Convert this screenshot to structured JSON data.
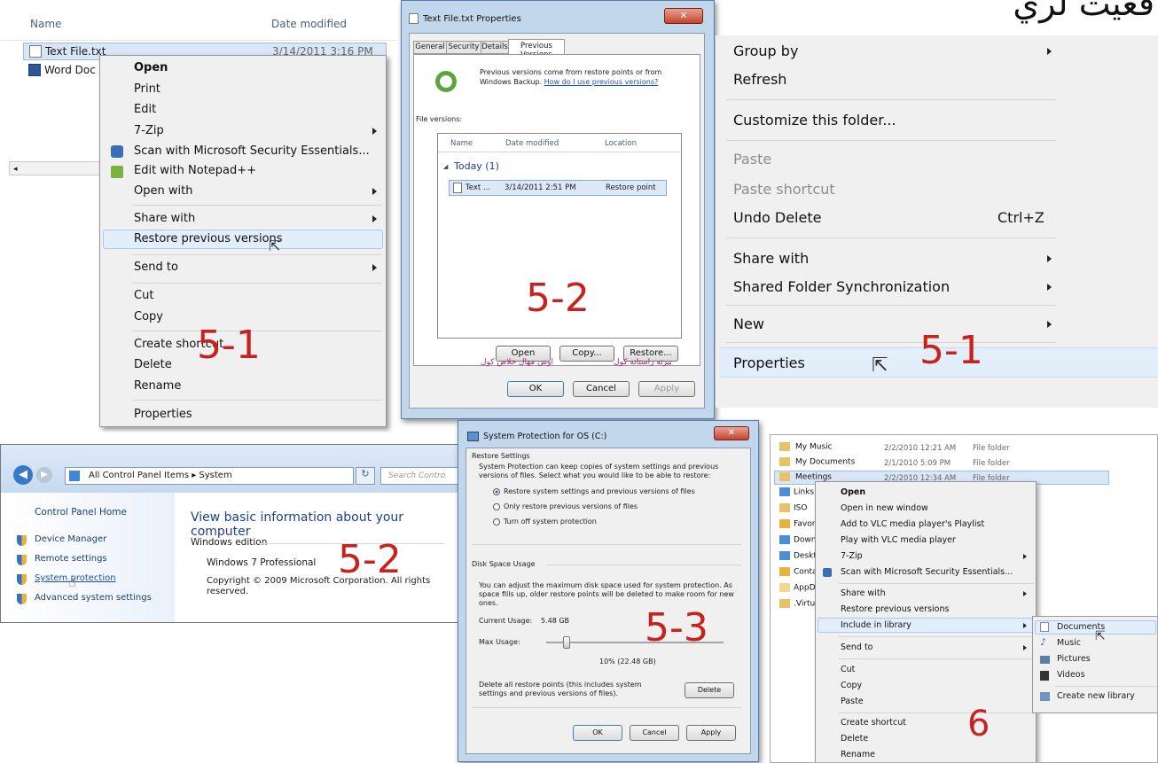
{
  "corner_text": "قعيت لري",
  "p1": {
    "col_name": "Name",
    "col_date": "Date modified",
    "files": [
      {
        "name": "Text File.txt",
        "date": "3/14/2011 3:16 PM"
      },
      {
        "name": "Word Doc -",
        "date": ""
      }
    ],
    "menu": [
      "Open",
      "Print",
      "Edit",
      "7-Zip",
      "Scan with Microsoft Security Essentials...",
      "Edit with Notepad++",
      "Open with",
      "Share with",
      "Restore previous versions",
      "Send to",
      "Cut",
      "Copy",
      "Create shortcut",
      "Delete",
      "Rename",
      "Properties"
    ],
    "label": "5-1"
  },
  "p2": {
    "title": "Text File.txt Properties",
    "tabs": [
      "General",
      "Security",
      "Details",
      "Previous Versions"
    ],
    "info": "Previous versions come from restore points or from Windows Backup.",
    "info_link": "How do I use previous versions?",
    "file_versions": "File versions:",
    "cols": [
      "Name",
      "Date modified",
      "Location"
    ],
    "group": "Today (1)",
    "row": {
      "name": "Text ...",
      "date": "3/14/2011 2:51 PM",
      "location": "Restore point"
    },
    "label": "5-2",
    "btns": [
      "Open",
      "Copy...",
      "Restore..."
    ],
    "note_left": "اوس مهال خلاص كول",
    "note_right": "بيرته راستانه كول",
    "footer_btns": [
      "OK",
      "Cancel",
      "Apply"
    ]
  },
  "p3": {
    "items": [
      {
        "label": "Group by",
        "arrow": true,
        "grey": false
      },
      {
        "label": "Refresh",
        "arrow": false,
        "grey": false
      },
      {
        "label": "Customize this folder...",
        "arrow": false,
        "grey": false
      },
      {
        "label": "Paste",
        "arrow": false,
        "grey": true
      },
      {
        "label": "Paste shortcut",
        "arrow": false,
        "grey": true
      },
      {
        "label": "Undo Delete",
        "arrow": false,
        "grey": false
      },
      {
        "label": "Share with",
        "arrow": true,
        "grey": false
      },
      {
        "label": "Shared Folder Synchronization",
        "arrow": true,
        "grey": false
      },
      {
        "label": "New",
        "arrow": true,
        "grey": false
      },
      {
        "label": "Properties",
        "arrow": false,
        "grey": false
      }
    ],
    "shortcut": "Ctrl+Z",
    "label": "5-1"
  },
  "p4": {
    "address": "All Control Panel Items ▸ System",
    "search_placeholder": "Search Contro",
    "home": "Control Panel Home",
    "links": [
      "Device Manager",
      "Remote settings",
      "System protection",
      "Advanced system settings"
    ],
    "heading": "View basic information about your computer",
    "edition_label": "Windows edition",
    "edition": "Windows 7 Professional",
    "copyright": "Copyright © 2009 Microsoft Corporation.  All rights reserved.",
    "label": "5-2"
  },
  "p5": {
    "title": "System Protection for OS (C:)",
    "restore_settings": "Restore Settings",
    "restore_desc": "System Protection can keep copies of system settings and previous versions of files. Select what you would like to be able to restore:",
    "options": [
      "Restore system settings and previous versions of files",
      "Only restore previous versions of files",
      "Turn off system protection"
    ],
    "disk_usage": "Disk Space Usage",
    "disk_desc": "You can adjust the maximum disk space used for system protection. As space fills up, older restore points will be deleted to make room for new ones.",
    "current_label": "Current Usage:",
    "current_value": "5.48 GB",
    "max_label": "Max Usage:",
    "max_value": "10% (22.48 GB)",
    "max_fraction": 0.1,
    "delete_desc": "Delete all restore points (this includes system settings and previous versions of files).",
    "delete_btn": "Delete",
    "footer_btns": [
      "OK",
      "Cancel",
      "Apply"
    ],
    "label": "5-3"
  },
  "p6": {
    "rows": [
      {
        "name": "My Music",
        "date": "2/2/2010 12:21 AM",
        "type": "File folder"
      },
      {
        "name": "My Documents",
        "date": "2/1/2010 5:09 PM",
        "type": "File folder"
      },
      {
        "name": "Meetings",
        "date": "2/2/2010 12:34 AM",
        "type": "File folder"
      }
    ],
    "side": [
      "Links",
      "ISO",
      "Favori",
      "Down",
      "Deskt",
      "Conta",
      "AppD",
      ".Virtu"
    ],
    "menu": [
      "Open",
      "Open in new window",
      "Add to VLC media player's Playlist",
      "Play with VLC media player",
      "7-Zip",
      "Scan with Microsoft Security Essentials...",
      "Share with",
      "Restore previous versions",
      "Include in library",
      "Send to",
      "Cut",
      "Copy",
      "Paste",
      "Create shortcut",
      "Delete",
      "Rename"
    ],
    "submenu": [
      "Documents",
      "Music",
      "Pictures",
      "Videos",
      "Create new library"
    ],
    "label": "6"
  }
}
